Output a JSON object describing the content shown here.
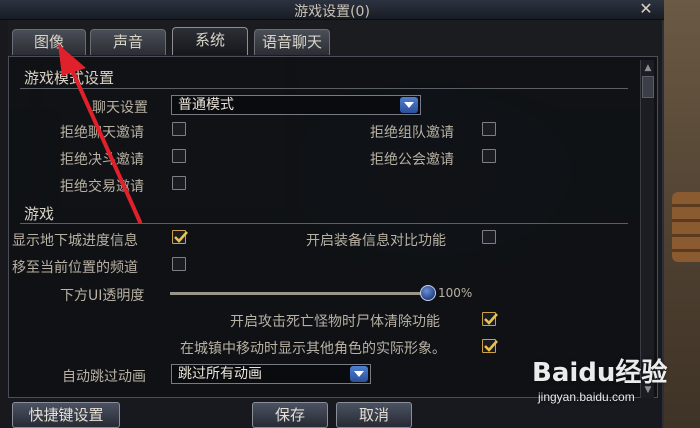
{
  "window": {
    "title": "游戏设置(0)",
    "close_glyph": "✕"
  },
  "tabs": [
    {
      "label": "图像",
      "active": false
    },
    {
      "label": "声音",
      "active": false
    },
    {
      "label": "系统",
      "active": true
    },
    {
      "label": "语音聊天",
      "active": false
    }
  ],
  "mode_section": {
    "heading": "游戏模式设置",
    "chat_setting_label": "聊天设置",
    "chat_setting_value": "普通模式",
    "options": [
      {
        "label": "拒绝聊天邀请",
        "checked": false
      },
      {
        "label": "拒绝组队邀请",
        "checked": false
      },
      {
        "label": "拒绝决斗邀请",
        "checked": false
      },
      {
        "label": "拒绝公会邀请",
        "checked": false
      },
      {
        "label": "拒绝交易邀请",
        "checked": false
      }
    ]
  },
  "game_section": {
    "heading": "游戏",
    "show_dungeon_progress": {
      "label": "显示地下城进度信息",
      "checked": true
    },
    "equip_compare": {
      "label": "开启装备信息对比功能",
      "checked": false
    },
    "move_channel": {
      "label": "移至当前位置的频道",
      "checked": false
    },
    "ui_opacity_label": "下方UI透明度",
    "ui_opacity_value": "100%",
    "ui_opacity_fraction": 1.0,
    "clear_corpse": {
      "label": "开启攻击死亡怪物时尸体清除功能",
      "checked": true
    },
    "show_others": {
      "label": "在城镇中移动时显示其他角色的实际形象。",
      "checked": true
    },
    "auto_skip_label": "自动跳过动画",
    "auto_skip_value": "跳过所有动画"
  },
  "buttons": {
    "hotkey": "快捷键设置",
    "save": "保存",
    "cancel": "取消"
  },
  "watermark": {
    "logo": "Baidu经验",
    "url": "jingyan.baidu.com"
  },
  "colors": {
    "annotation_arrow": "#e0202a",
    "checkbox_tick": "#e8c24c",
    "accent_blue": "#3f6fc4"
  }
}
